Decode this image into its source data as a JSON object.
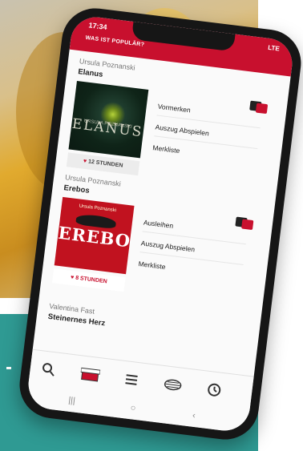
{
  "app": {
    "status_time": "17:34",
    "status_signal": "LTE",
    "title": "WAS IST POPULÄR?"
  },
  "books": [
    {
      "author": "Ursula Poznanski",
      "title": "Elanus",
      "cover_title": "ELANUS",
      "cover_author": "URSULA POZNANSKI",
      "duration": "12 STUNDEN",
      "actions": [
        "Vormerken",
        "Auszug Abspielen",
        "Merkliste"
      ]
    },
    {
      "author": "Ursula Poznanski",
      "title": "Erebos",
      "cover_title": "EREBOS",
      "cover_author": "Ursula Poznanski",
      "duration": "8 STUNDEN",
      "actions": [
        "Ausleihen",
        "Auszug Abspielen",
        "Merkliste"
      ]
    },
    {
      "author": "Valentina Fast",
      "title": "Steinernes Herz"
    }
  ],
  "nav": {
    "icons": [
      "search-icon",
      "box-icon",
      "menu-icon",
      "reel-icon",
      "history-icon"
    ]
  },
  "system_nav": [
    "|||",
    "○",
    "‹"
  ],
  "colors": {
    "accent": "#c8102e",
    "teal": "#2f9a93",
    "phone": "#161616"
  }
}
